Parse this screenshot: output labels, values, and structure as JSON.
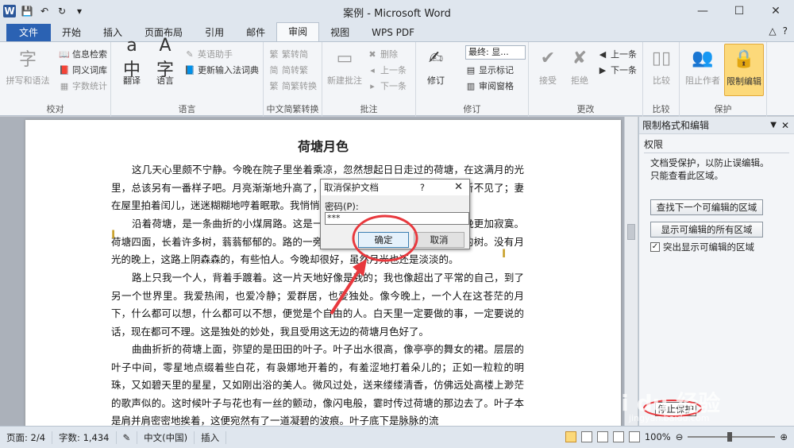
{
  "app": {
    "title": "案例 - Microsoft Word",
    "logo": "W"
  },
  "window_controls": {
    "minimize": "—",
    "maximize": "☐",
    "close": "✕"
  },
  "tabs": [
    {
      "label": "文件"
    },
    {
      "label": "开始"
    },
    {
      "label": "插入"
    },
    {
      "label": "页面布局"
    },
    {
      "label": "引用"
    },
    {
      "label": "邮件"
    },
    {
      "label": "审阅"
    },
    {
      "label": "视图"
    },
    {
      "label": "WPS PDF"
    }
  ],
  "tab_right": {
    "collapse": "△",
    "help": "?"
  },
  "ribbon": {
    "proofing": {
      "label": "校对",
      "spell": "拼写和语法",
      "research": "信息检索",
      "thesaurus": "同义词库",
      "wordcount": "字数统计"
    },
    "language": {
      "label": "语言",
      "translate": "翻译",
      "language": "语言",
      "ime": "英语助手",
      "update_ime": "更新输入法词典"
    },
    "chinese": {
      "label": "中文简繁转换",
      "to_trad": "繁转简",
      "to_simp": "简转繁",
      "convert": "简繁转换"
    },
    "comments": {
      "label": "批注",
      "new": "新建批注",
      "delete": "删除",
      "prev": "上一条",
      "next": "下一条"
    },
    "tracking": {
      "label": "修订",
      "track": "修订",
      "display": "最终: 显...",
      "show_markup": "显示标记",
      "pane": "审阅窗格"
    },
    "changes": {
      "label": "更改",
      "accept": "接受",
      "reject": "拒绝",
      "prev": "上一条",
      "next": "下一条"
    },
    "compare": {
      "label": "比较",
      "compare": "比较"
    },
    "protect": {
      "label": "保护",
      "block": "阻止作者",
      "restrict": "限制编辑"
    }
  },
  "document": {
    "title": "荷塘月色",
    "paragraphs": [
      "这几天心里颇不宁静。今晚在院子里坐着乘凉，忽然想起日日走过的荷塘，在这满月的光里，总该另有一番样子吧。月亮渐渐地升高了，墙外马路上孩子们的欢笑，已经听不见了；妻在屋里拍着闰儿，迷迷糊糊地哼着眠歌。我悄悄地披了大衫，带上门出去。",
      "沿着荷塘，是一条曲折的小煤屑路。这是一条幽僻的路；白天也少人走，夜晚更加寂寞。荷塘四面，长着许多树，蓊蓊郁郁的。路的一旁，是些杨柳，和一些不知道名字的树。没有月光的晚上，这路上阴森森的，有些怕人。今晚却很好，虽然月光也还是淡淡的。",
      "路上只我一个人，背着手踱着。这一片天地好像是我的；我也像超出了平常的自己，到了另一个世界里。我爱热闹，也爱冷静；爱群居，也爱独处。像今晚上，一个人在这苍茫的月下，什么都可以想，什么都可以不想，便觉是个自由的人。白天里一定要做的事，一定要说的话，现在都可不理。这是独处的妙处，我且受用这无边的荷塘月色好了。",
      "曲曲折折的荷塘上面，弥望的是田田的叶子。叶子出水很高，像亭亭的舞女的裙。层层的叶子中间，零星地点缀着些白花，有袅娜地开着的，有羞涩地打着朵儿的；正如一粒粒的明珠，又如碧天里的星星，又如刚出浴的美人。微风过处，送来缕缕清香，仿佛远处高楼上渺茫的歌声似的。这时候叶子与花也有一丝的颤动，像闪电般，霎时传过荷塘的那边去了。叶子本是肩并肩密密地挨着，这便宛然有了一道凝碧的波痕。叶子底下是脉脉的流"
    ]
  },
  "dialog": {
    "title": "取消保护文档",
    "help": "?",
    "close": "✕",
    "label": "密码(P):",
    "value": "***",
    "ok": "确定",
    "cancel": "取消"
  },
  "pane": {
    "title": "限制格式和编辑",
    "section": "权限",
    "text1": "文档受保护，以防止误编辑。",
    "text2": "只能查看此区域。",
    "btn_next": "查找下一个可编辑的区域",
    "btn_all": "显示可编辑的所有区域",
    "check_label": "突出显示可编辑的区域",
    "stop": "停止保护"
  },
  "status": {
    "page": "页面: 2/4",
    "words": "字数: 1,434",
    "lang": "中文(中国)",
    "mode": "插入",
    "zoom": "100%"
  },
  "watermark": {
    "brand": "Bai du 经验",
    "url": "jingyan.baidu.com"
  },
  "colors": {
    "accent": "#2b579a",
    "arrow": "#e8383d",
    "restrict_highlight": "#fcd97a"
  }
}
